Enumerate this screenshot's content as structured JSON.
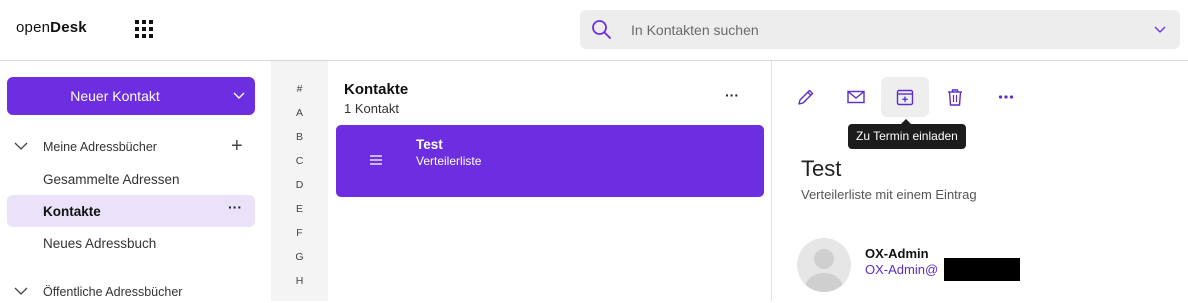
{
  "header": {
    "logo_prefix": "open",
    "logo_bold": "Desk",
    "search_placeholder": "In Kontakten suchen"
  },
  "sidebar": {
    "new_button_label": "Neuer Kontakt",
    "section_my": "Meine Adressbücher",
    "items": [
      {
        "label": "Gesammelte Adressen"
      },
      {
        "label": "Kontakte",
        "active": true,
        "more": "···"
      },
      {
        "label": "Neues Adressbuch"
      }
    ],
    "section_public": "Öffentliche Adressbücher"
  },
  "alphabet": [
    "#",
    "A",
    "B",
    "C",
    "D",
    "E",
    "F",
    "G",
    "H"
  ],
  "list": {
    "title": "Kontakte",
    "count": "1 Kontakt",
    "more": "···",
    "card": {
      "name": "Test",
      "type": "Verteilerliste"
    }
  },
  "detail": {
    "toolbar": [
      {
        "icon": "pencil-icon",
        "label": "Bearbeiten"
      },
      {
        "icon": "envelope-icon",
        "label": "E-Mail"
      },
      {
        "icon": "calendar-plus-icon",
        "label": "Zu Termin einladen"
      },
      {
        "icon": "trash-icon",
        "label": "Löschen"
      },
      {
        "icon": "more-icon",
        "label": "Mehr"
      }
    ],
    "tooltip": "Zu Termin einladen",
    "title": "Test",
    "subtitle": "Verteilerliste mit einem Eintrag",
    "member": {
      "name": "OX-Admin",
      "email_prefix": "OX-Admin@"
    }
  },
  "colors": {
    "accent": "#6c2ee0",
    "active_bg": "#e9e2f8",
    "icon_purple": "#5b2ec7"
  }
}
